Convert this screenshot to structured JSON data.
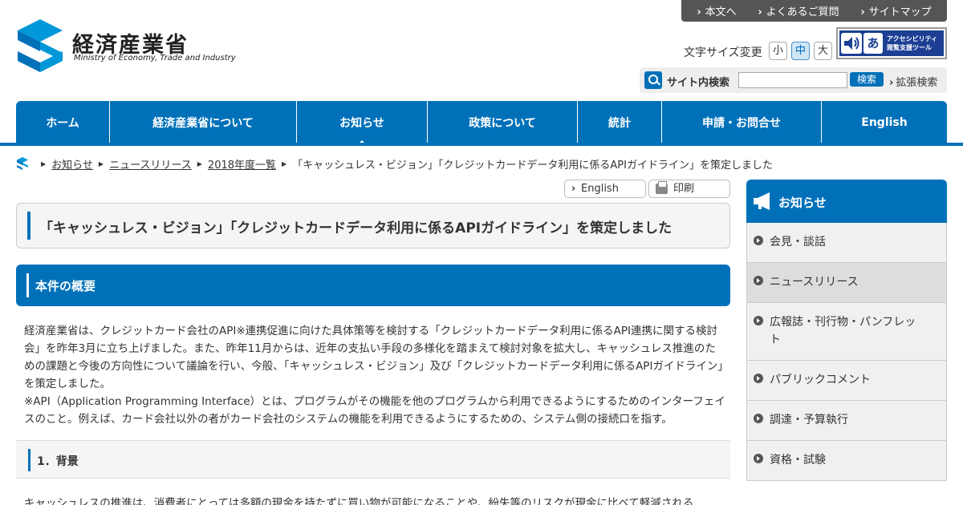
{
  "top_links": [
    "本文へ",
    "よくあるご質問",
    "サイトマップ"
  ],
  "logo": {
    "title": "経済産業省",
    "subtitle": "Ministry of Economy, Trade and Industry"
  },
  "font_size": {
    "label": "文字サイズ変更",
    "small": "小",
    "medium": "中",
    "large": "大",
    "selected": "中"
  },
  "accessibility": {
    "icon": "あ",
    "line1": "アクセシビリティ",
    "line2": "閲覧支援ツール"
  },
  "search": {
    "label": "サイト内検索",
    "value": "",
    "button": "検索",
    "advanced": "拡張検索"
  },
  "nav": [
    "ホーム",
    "経済産業省について",
    "お知らせ",
    "政策について",
    "統計",
    "申請・お問合せ",
    "English"
  ],
  "nav_current": "お知らせ",
  "breadcrumb": [
    "お知らせ",
    "ニュースリリース",
    "2018年度一覧",
    "「キャッシュレス・ビジョン」「クレジットカードデータ利用に係るAPIガイドライン」を策定しました"
  ],
  "utility": {
    "english": "English",
    "print": "印刷"
  },
  "page_title": "「キャッシュレス・ビジョン」「クレジットカードデータ利用に係るAPIガイドライン」を策定しました",
  "section_title": "本件の概要",
  "body": "経済産業省は、クレジットカード会社のAPI※連携促進に向けた具体策等を検討する「クレジットカードデータ利用に係るAPI連携に関する検討会」を昨年3月に立ち上げました。また、昨年11月からは、近年の支払い手段の多様化を踏まえて検討対象を拡大し、キャッシュレス推進のための課題と今後の方向性について議論を行い、今般、「キャッシュレス・ビジョン」及び「クレジットカードデータ利用に係るAPIガイドライン」を策定しました。",
  "body_note": "※API（Application Programming Interface）とは、プログラムがその機能を他のプログラムから利用できるようにするためのインターフェイスのこと。例えば、カード会社以外の者がカード会社のシステムの機能を利用できるようにするための、システム側の接続口を指す。",
  "subsection_title": "1．背景",
  "body2": "キャッシュレスの推進は、消費者にとっては多額の現金を持たずに買い物が可能になることや、紛失等のリスクが現金に比べて軽減される",
  "sidebar": {
    "title": "お知らせ",
    "items": [
      "会見・談話",
      "ニュースリリース",
      "広報誌・刊行物・パンフレット",
      "パブリックコメント",
      "調達・予算執行",
      "資格・試験"
    ],
    "active": "ニュースリリース"
  }
}
